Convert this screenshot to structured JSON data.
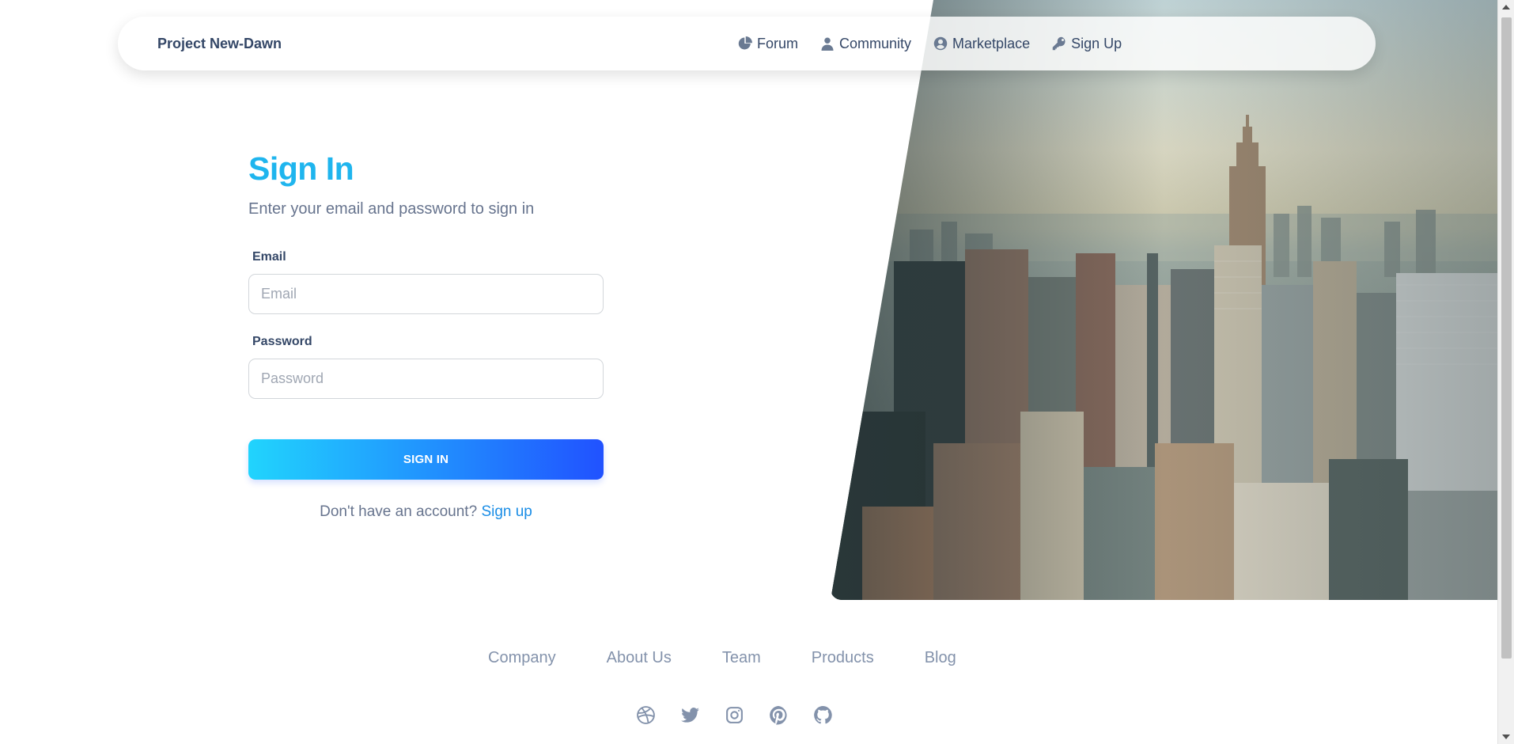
{
  "navbar": {
    "brand": "Project New-Dawn",
    "links": [
      {
        "label": "Forum",
        "icon": "pie-chart-icon"
      },
      {
        "label": "Community",
        "icon": "user-icon"
      },
      {
        "label": "Marketplace",
        "icon": "user-circle-icon"
      },
      {
        "label": "Sign Up",
        "icon": "key-icon"
      }
    ]
  },
  "form": {
    "title": "Sign In",
    "subtitle": "Enter your email and password to sign in",
    "email_label": "Email",
    "email_placeholder": "Email",
    "email_value": "",
    "password_label": "Password",
    "password_placeholder": "Password",
    "password_value": "",
    "submit_label": "SIGN IN",
    "signup_prompt": "Don't have an account?",
    "signup_link": "Sign up"
  },
  "footer": {
    "links": [
      "Company",
      "About Us",
      "Team",
      "Products",
      "Blog"
    ],
    "socials": [
      "dribbble-icon",
      "twitter-icon",
      "instagram-icon",
      "pinterest-icon",
      "github-icon"
    ]
  },
  "colors": {
    "accent": "#1fb5ee",
    "gradient_start": "#21d4fd",
    "gradient_end": "#2152ff",
    "text_dark": "#344767",
    "text_muted": "#67748e"
  }
}
